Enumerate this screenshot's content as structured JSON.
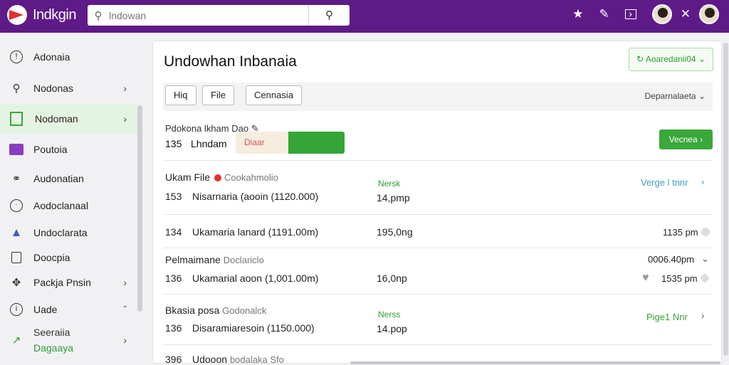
{
  "topbar": {
    "app_name": "Indkgin",
    "search_placeholder": "lndowan",
    "search_button_icon": "search-icon",
    "icons": [
      "star-icon",
      "pencil-icon",
      "terminal-icon",
      "avatar",
      "close-icon",
      "avatar"
    ]
  },
  "sidebar": {
    "items": [
      {
        "label": "Adonaia",
        "icon": "alert-circle-icon",
        "chevron": false
      },
      {
        "label": "Nodonas",
        "icon": "key-icon",
        "chevron": true
      },
      {
        "label": "Nodoman",
        "icon": "square-icon",
        "chevron": true,
        "active": true
      },
      {
        "label": "Poutoia",
        "icon": "list-icon",
        "chevron": false
      },
      {
        "label": "Audonatian",
        "icon": "tag-icon",
        "chevron": false
      },
      {
        "label": "Aodoclanaal",
        "icon": "clock-icon",
        "chevron": false
      },
      {
        "label": "Undoclarata",
        "icon": "mountain-icon",
        "chevron": false
      },
      {
        "label": "Doocpia",
        "icon": "document-icon",
        "chevron": false
      },
      {
        "label": "Packja Pnsin",
        "icon": "move-icon",
        "chevron": true
      },
      {
        "label": "Uade",
        "icon": "info-icon",
        "chevron": "up"
      },
      {
        "label": "Seeraiia",
        "sublabel": "Dagaaya",
        "icon": "chart-icon",
        "chevron": true
      }
    ]
  },
  "main": {
    "title": "Undowhan Inbanaia",
    "badge": "Aoaredanii04",
    "toolbar": {
      "buttons": [
        "Hiq",
        "File",
        "Cennasia"
      ],
      "right_label": "Deparnalaeta"
    },
    "row1": {
      "label": "Pdokona lkham Dao",
      "number": "135",
      "name": "Lhndam",
      "status": "Diaar",
      "button": "Vecnea"
    },
    "rows": [
      {
        "title": "Ukam File",
        "subtitle": "Cookahmolio",
        "tag": "Nersk",
        "number": "153",
        "desc": "Nisarnaria (aooin (1120.000)",
        "value": "14,pmp",
        "right": "Verge l tnnr"
      },
      {
        "number": "134",
        "desc": "Ukamaria lanard (1191.00m)",
        "value": "195,0ng",
        "right": "1135 pm"
      },
      {
        "title": "Pelmaimane",
        "subtitle": "Doclariclo",
        "number": "136",
        "desc": "Ukamarial aoon (1,001.00m)",
        "value": "16,0np",
        "right_top": "0006.40pm",
        "right": "1535 pm"
      },
      {
        "title": "Bkasia posa",
        "subtitle": "Godonalck",
        "tag": "Nerss",
        "number": "136",
        "desc": "Disaramiaresoin (1150.000)",
        "value": "14.pop",
        "right": "Pige1 Nnr"
      },
      {
        "number": "396",
        "desc": "Udooon",
        "subtitle": "bodalaka Sfo"
      }
    ]
  }
}
